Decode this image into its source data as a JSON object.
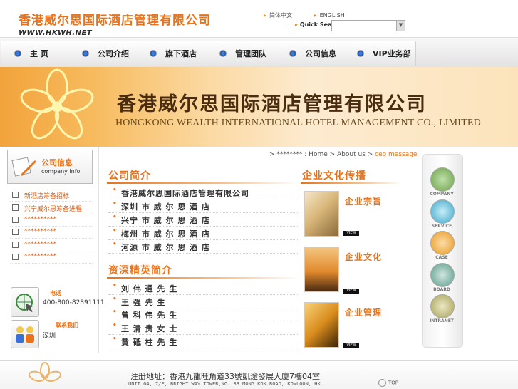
{
  "header": {
    "logo_cn": "香港威尔思国际酒店管理有限公司",
    "logo_url": "WWW.HKWH.NET",
    "lang_cn": "简体中文",
    "lang_en": "ENGLISH",
    "quick_search_label": "Quick Search",
    "search_placeholder": ""
  },
  "nav": [
    {
      "label": "主  页",
      "icon": "bullet-icon"
    },
    {
      "label": "公司介绍",
      "icon": "bullet-icon"
    },
    {
      "label": "旗下酒店",
      "icon": "bullet-icon"
    },
    {
      "label": "管理团队",
      "icon": "bullet-icon"
    },
    {
      "label": "公司信息",
      "icon": "bullet-icon"
    },
    {
      "label": "VIP业务部",
      "icon": "bullet-icon"
    }
  ],
  "banner": {
    "title_cn": "香港威尔思国际酒店管理有限公司",
    "title_en": "HONGKONG WEALTH INTERNATIONAL HOTEL MANAGEMENT CO., LIMITED"
  },
  "left": {
    "info_title": "公司信息",
    "info_sub": "company info",
    "items": [
      "新酒店筹备招标",
      "兴宁威尔思筹备进程",
      "**********",
      "**********",
      "**********",
      "**********"
    ],
    "phone_label": "电话",
    "phone_number": "400-800-82891111",
    "contact_label": "联系我们",
    "contact_city": "深圳"
  },
  "breadcrumb": {
    "prefix": ">  ********",
    "items": [
      "Home",
      "About us",
      "ceo message"
    ]
  },
  "company": {
    "title": "公司简介",
    "items": [
      "香港威尔思国际酒店管理有限公司",
      "深圳 市 威 尔 思 酒 店",
      "兴宁 市 威 尔 思 酒 店",
      "梅州 市 威 尔 思 酒 店",
      "河源 市 威 尔 思 酒 店"
    ]
  },
  "elite": {
    "title": "资深精英简介",
    "items": [
      "刘 伟 通 先 生",
      "王 强 先 生",
      "曾 科 伟 先 生",
      "王 清 贵 女 士",
      "黄 砥 柱 先 生"
    ]
  },
  "culture": {
    "title": "企业文化传播",
    "items": [
      {
        "label": "企业宗旨",
        "view": "VIEW"
      },
      {
        "label": "企业文化",
        "view": "VIEW"
      },
      {
        "label": "企业管理",
        "view": "VIEW"
      }
    ]
  },
  "right_icons": [
    {
      "label": "COMPANY",
      "icon": "company-icon",
      "color": "#6ba04a"
    },
    {
      "label": "SERVICE",
      "icon": "service-icon",
      "color": "#3fa7c9"
    },
    {
      "label": "CASE",
      "icon": "case-icon",
      "color": "#e89a23"
    },
    {
      "label": "BOARD",
      "icon": "board-icon",
      "color": "#5b9a8a"
    },
    {
      "label": "INTRANET",
      "icon": "intranet-icon",
      "color": "#a6a05a"
    }
  ],
  "footer": {
    "address_cn": "注册地址：香港九龍旺角道33號凱途發展大廈7樓04室",
    "address_en": "UNIT 04, 7/F, BRIGHT WAY TOWER,NO. 33 MONG KOK ROAD, KOWLOON, HK.",
    "top_label": "TOP"
  }
}
